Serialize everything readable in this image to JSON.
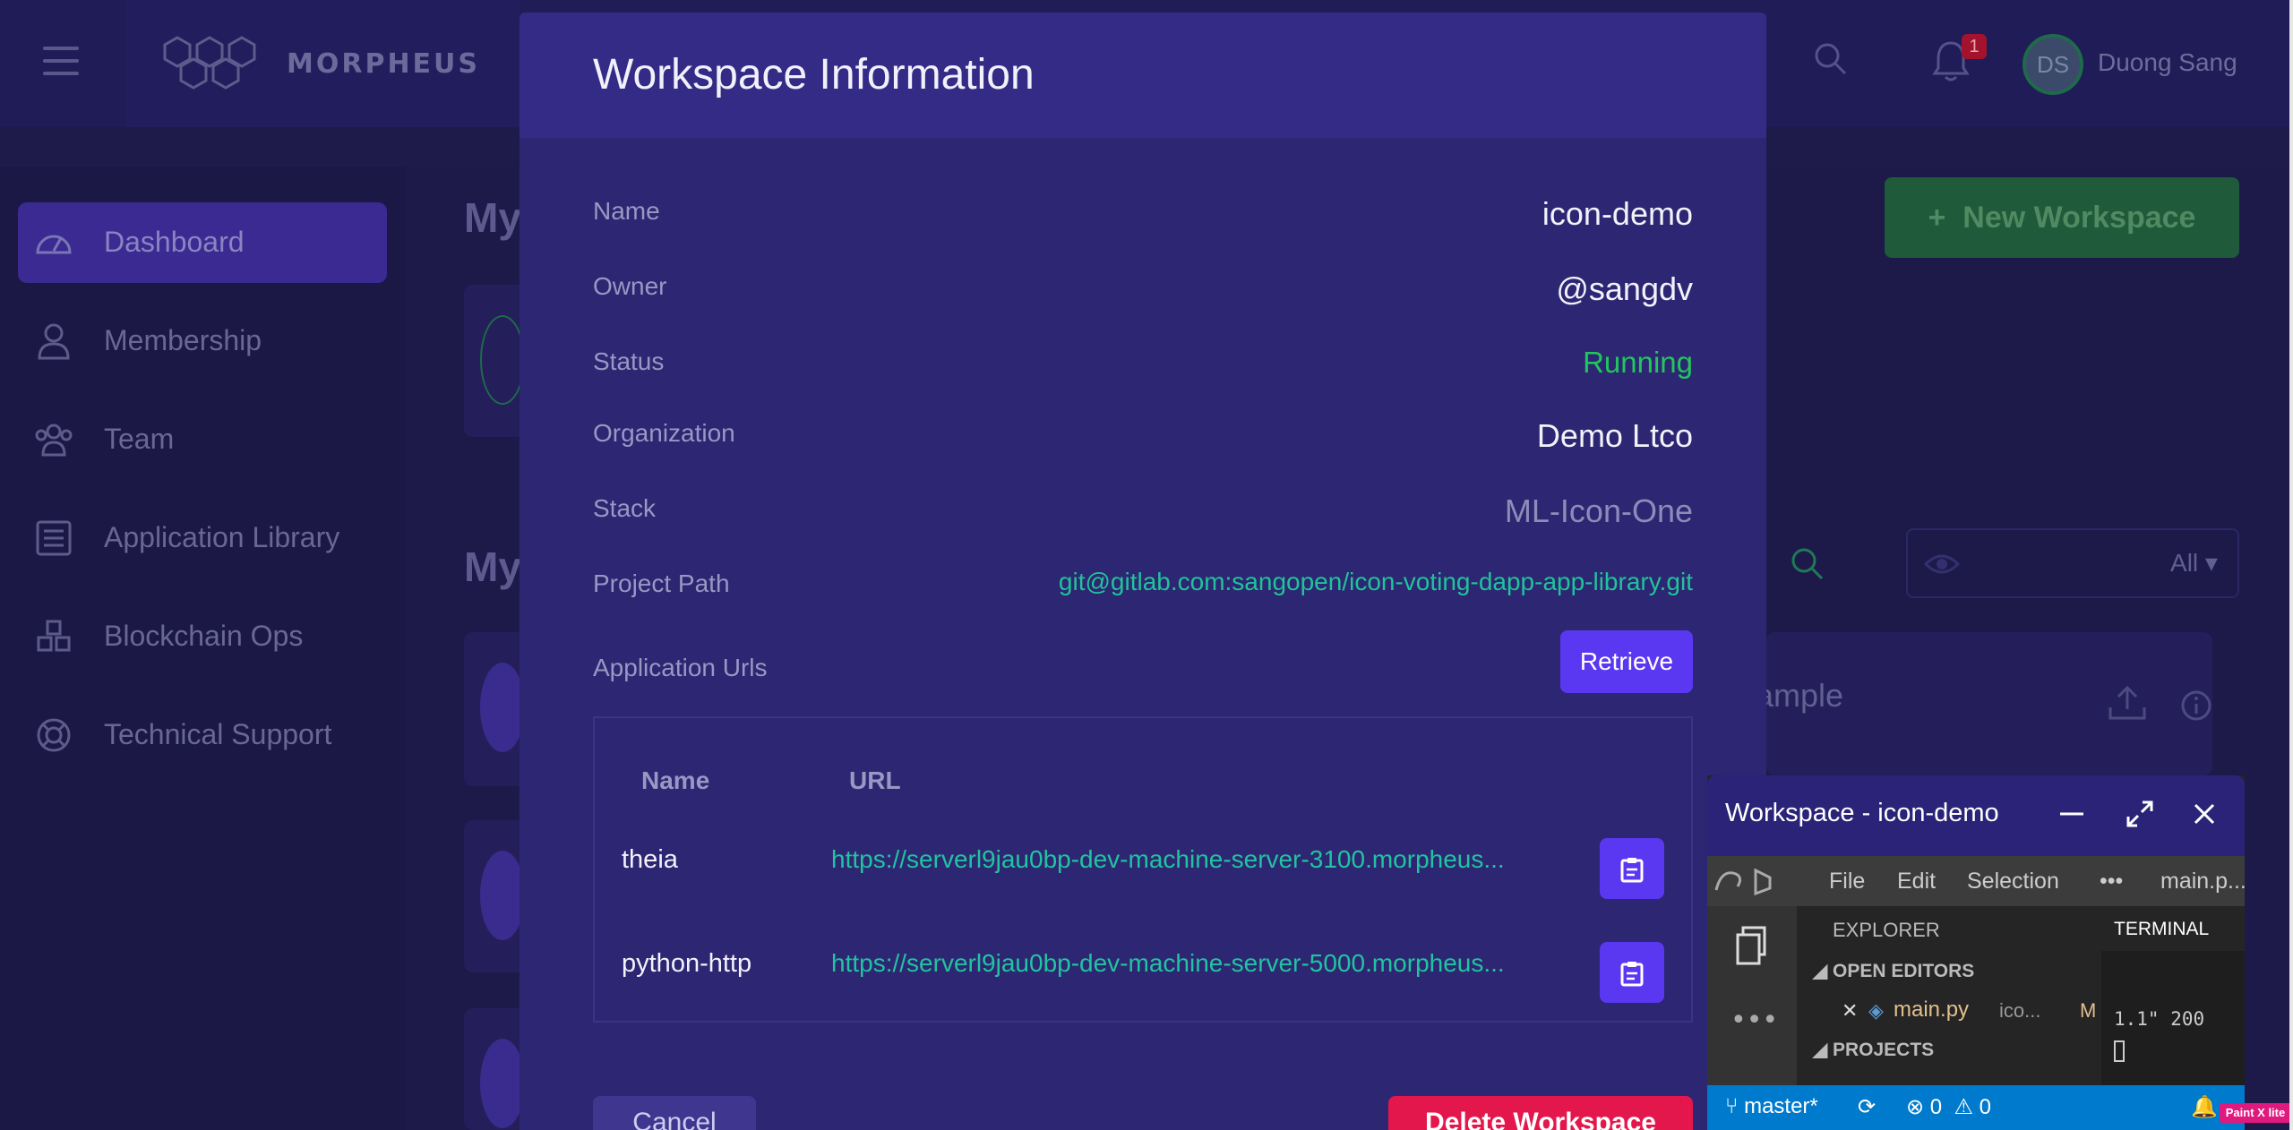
{
  "app": {
    "brand": "MORPHEUS",
    "user_initials": "DS",
    "user_name": "Duong Sang",
    "notification_count": "1"
  },
  "sidebar": {
    "items": [
      {
        "label": "Dashboard",
        "icon": "dashboard-gauge-icon",
        "active": true
      },
      {
        "label": "Membership",
        "icon": "user-icon"
      },
      {
        "label": "Team",
        "icon": "team-icon"
      },
      {
        "label": "Application Library",
        "icon": "list-icon"
      },
      {
        "label": "Blockchain Ops",
        "icon": "cubes-icon"
      },
      {
        "label": "Technical Support",
        "icon": "lifebuoy-icon"
      }
    ]
  },
  "background": {
    "heading_1": "My",
    "heading_2": "My",
    "new_workspace_label": "New Workspace",
    "filter_value": "All",
    "card_partial_text": "ample"
  },
  "modal": {
    "title": "Workspace Information",
    "fields": {
      "name_label": "Name",
      "name_value": "icon-demo",
      "owner_label": "Owner",
      "owner_value": "@sangdv",
      "status_label": "Status",
      "status_value": "Running",
      "organization_label": "Organization",
      "organization_value": "Demo Ltco",
      "stack_label": "Stack",
      "stack_value": "ML-Icon-One",
      "project_path_label": "Project Path",
      "project_path_value": "git@gitlab.com:sangopen/icon-voting-dapp-app-library.git",
      "app_urls_label": "Application Urls"
    },
    "retrieve_label": "Retrieve",
    "table": {
      "headers": [
        "Name",
        "URL"
      ],
      "rows": [
        {
          "name": "theia",
          "url": "https://serverl9jau0bp-dev-machine-server-3100.morpheus..."
        },
        {
          "name": "python-http",
          "url": "https://serverl9jau0bp-dev-machine-server-5000.morpheus..."
        }
      ]
    },
    "cancel_label": "Cancel",
    "delete_label": "Delete Workspace"
  },
  "workspace_window": {
    "title": "Workspace - icon-demo",
    "menu": [
      "File",
      "Edit",
      "Selection",
      "•••",
      "main.p..."
    ],
    "explorer_title": "EXPLORER",
    "open_editors": "OPEN EDITORS",
    "file_name": "main.py",
    "file_path": "ico...",
    "file_status": "M",
    "projects": "PROJECTS",
    "terminal_title": "TERMINAL",
    "terminal_line": "1.1\" 200",
    "branch": "master*",
    "errors": "0",
    "warnings": "0"
  },
  "watermark": "Paint X lite",
  "colors": {
    "accent": "#5a38f2",
    "status_running": "#22c55e",
    "link": "#22c3a0",
    "danger": "#e4174c"
  }
}
